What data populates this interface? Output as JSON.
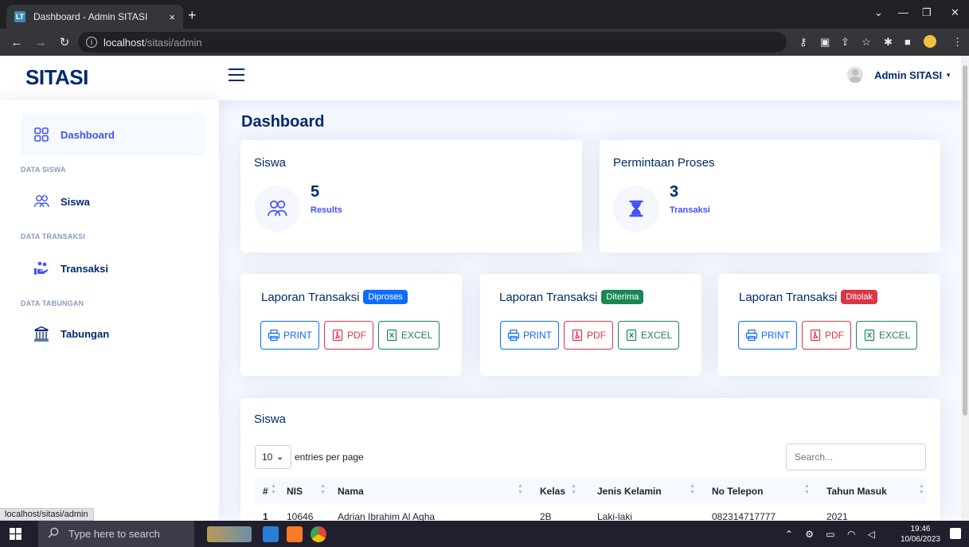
{
  "browser": {
    "tab_title": "Dashboard - Admin SITASI",
    "tab_close": "×",
    "new_tab": "+",
    "url_host": "localhost",
    "url_path": "/sitasi/admin"
  },
  "header": {
    "logo": "SITASI",
    "user_name": "Admin SITASI"
  },
  "sidebar": {
    "items": [
      {
        "label": "Dashboard",
        "icon": "grid-icon"
      },
      {
        "label": "Siswa",
        "icon": "people-icon"
      },
      {
        "label": "Transaksi",
        "icon": "hand-coins-icon"
      },
      {
        "label": "Tabungan",
        "icon": "bank-icon"
      }
    ],
    "headings": [
      "DATA SISWA",
      "DATA TRANSAKSI",
      "DATA TABUNGAN"
    ]
  },
  "main": {
    "title": "Dashboard",
    "stats": [
      {
        "title": "Siswa",
        "value": "5",
        "sub": "Results",
        "icon": "people-icon"
      },
      {
        "title": "Permintaan Proses",
        "value": "3",
        "sub": "Transaksi",
        "icon": "hourglass-icon"
      }
    ],
    "reports": [
      {
        "title": "Laporan Transaksi",
        "badge": "Diproses",
        "badge_color": "#0d6efd"
      },
      {
        "title": "Laporan Transaksi",
        "badge": "Diterima",
        "badge_color": "#198754"
      },
      {
        "title": "Laporan Transaksi",
        "badge": "Ditolak",
        "badge_color": "#dc3545"
      }
    ],
    "buttons": {
      "print": "PRINT",
      "pdf": "PDF",
      "excel": "EXCEL"
    }
  },
  "table": {
    "title": "Siswa",
    "page_size": "10",
    "entries_label": "entries per page",
    "search_placeholder": "Search...",
    "columns": [
      "#",
      "NIS",
      "Nama",
      "Kelas",
      "Jenis Kelamin",
      "No Telepon",
      "Tahun Masuk"
    ],
    "rows": [
      [
        "1",
        "10646",
        "Adrian Ibrahim Al Agha",
        "2B",
        "Laki-laki",
        "082314717777",
        "2021"
      ]
    ]
  },
  "statusbar": {
    "url": "localhost/sitasi/admin"
  },
  "taskbar": {
    "search_placeholder": "Type here to search",
    "time": "19:46",
    "date": "10/06/2023"
  },
  "colors": {
    "brand": "#012970",
    "accent": "#4154f1"
  }
}
